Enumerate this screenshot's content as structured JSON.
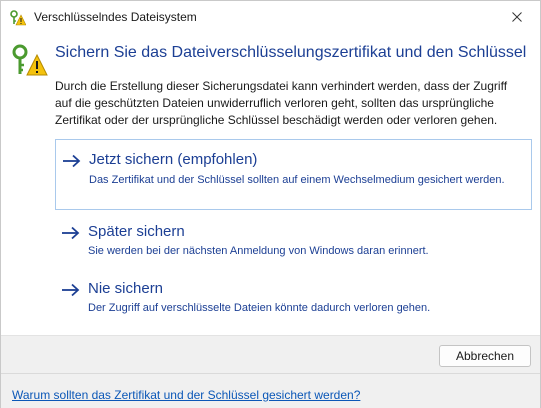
{
  "window": {
    "title": "Verschlüsselndes Dateisystem",
    "close_icon": "close-icon",
    "app_icon": "key-warning-icon"
  },
  "main": {
    "heading": "Sichern Sie das Dateiverschlüsselungszertifikat und den Schlüssel",
    "description": "Durch die Erstellung dieser Sicherungsdatei kann verhindert werden, dass der Zugriff auf die geschützten Dateien unwiderruflich verloren geht, sollten das ursprüngliche Zertifikat oder der ursprüngliche Schlüssel beschädigt werden oder verloren gehen.",
    "options": [
      {
        "title": "Jetzt sichern (empfohlen)",
        "description": "Das Zertifikat und der Schlüssel sollten auf einem Wechselmedium gesichert werden."
      },
      {
        "title": "Später sichern",
        "description": "Sie werden bei der nächsten Anmeldung von Windows daran erinnert."
      },
      {
        "title": "Nie sichern",
        "description": "Der Zugriff auf verschlüsselte Dateien könnte dadurch verloren gehen."
      }
    ]
  },
  "footer": {
    "cancel_label": "Abbrechen",
    "help_link": "Warum sollten das Zertifikat und der Schlüssel gesichert werden?"
  },
  "colors": {
    "accent": "#1c3f94",
    "link": "#0b57b7",
    "selection_border": "#a9c9ec",
    "key_icon": "#4b9a2f",
    "warning_icon": "#f4c20d"
  }
}
